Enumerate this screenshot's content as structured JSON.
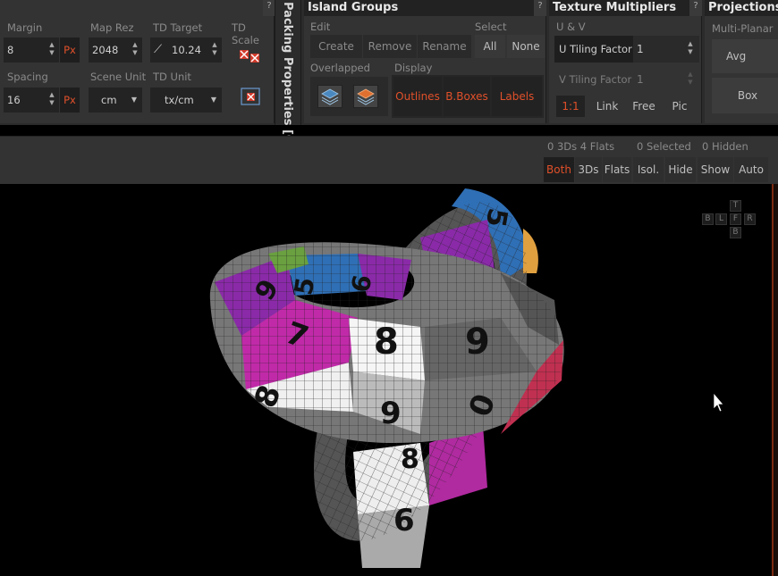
{
  "packing": {
    "margin_label": "Margin",
    "margin_value": "8",
    "margin_unit": "Px",
    "maprez_label": "Map Rez",
    "maprez_value": "2048",
    "tdtarget_label": "TD Target",
    "tdtarget_value": "10.24",
    "tdscale_label": "TD Scale",
    "spacing_label": "Spacing",
    "spacing_value": "16",
    "spacing_unit": "Px",
    "sceneunit_label": "Scene Unit",
    "sceneunit_value": "cm",
    "tdunit_label": "TD Unit",
    "tdunit_value": "tx/cm",
    "vertical_tab": "Packing Properties [Gl"
  },
  "island_groups": {
    "title": "Island Groups",
    "help": "?",
    "edit_label": "Edit",
    "create": "Create",
    "remove": "Remove",
    "rename": "Rename",
    "select_label": "Select",
    "all": "All",
    "none": "None",
    "overlapped_label": "Overlapped",
    "display_label": "Display",
    "outlines": "Outlines",
    "bboxes": "B.Boxes",
    "labels": "Labels"
  },
  "texture_multipliers": {
    "title": "Texture Multipliers",
    "help": "?",
    "uv_label": "U & V",
    "u_label": "U Tiling Factor",
    "u_value": "1",
    "v_label": "V Tiling Factor",
    "v_value": "1",
    "ratio": "1:1",
    "link": "Link",
    "free": "Free",
    "pic": "Pic"
  },
  "projections": {
    "title": "Projections",
    "help": "?",
    "multiplanar_label": "Multi-Planar",
    "avg_normal": "Avg Norma",
    "box": "Box"
  },
  "viewport_toolbar": {
    "counts": "0 3Ds 4 Flats",
    "selected": "0 Selected",
    "hidden": "0 Hidden",
    "both": "Both",
    "threeds": "3Ds",
    "flats": "Flats",
    "isol": "Isol.",
    "hide": "Hide",
    "show": "Show",
    "auto": "Auto"
  },
  "gizmo": {
    "t": "T",
    "b": "B",
    "l": "L",
    "f": "F",
    "r": "R",
    "b2": "B"
  },
  "colors": {
    "accent": "#e0502a",
    "panel_bg": "#333333",
    "header_bg": "#222222"
  }
}
